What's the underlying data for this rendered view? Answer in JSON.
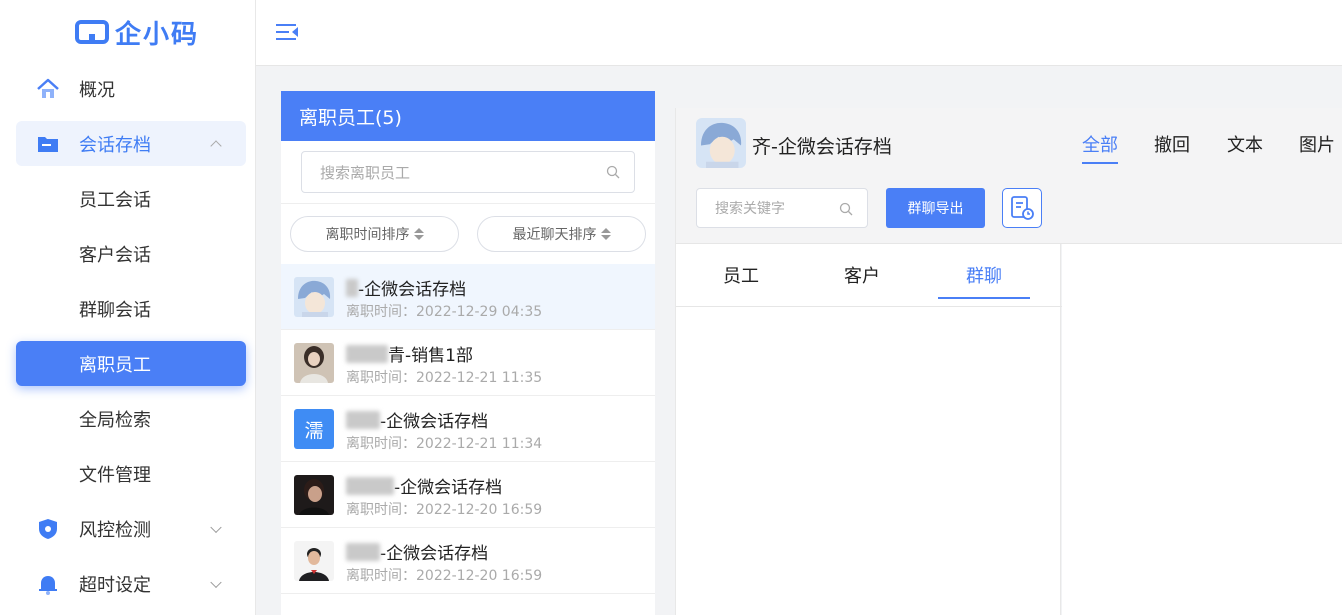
{
  "brand": {
    "name": "企小码",
    "color": "#3f7cf4"
  },
  "sidebar": {
    "items": [
      {
        "label": "概况",
        "icon": "home-icon"
      },
      {
        "label": "会话存档",
        "icon": "folder-icon",
        "state": "open"
      },
      {
        "label": "员工会话"
      },
      {
        "label": "客户会话"
      },
      {
        "label": "群聊会话"
      },
      {
        "label": "离职员工",
        "state": "active"
      },
      {
        "label": "全局检索"
      },
      {
        "label": "文件管理"
      },
      {
        "label": "风控检测",
        "icon": "shield-icon"
      },
      {
        "label": "超时设定",
        "icon": "bell-icon"
      }
    ]
  },
  "resigned": {
    "title": "离职员工(5)",
    "search_placeholder": "搜索离职员工",
    "sort_by_resign": "离职时间排序",
    "sort_by_chat": "最近聊天排序",
    "employees": [
      {
        "name": "-企微会话存档",
        "time": "离职时间：2022-12-29 04:35",
        "avatar": "anime-boy-avatar"
      },
      {
        "name": "青-销售1部",
        "time": "离职时间：2022-12-21 11:35",
        "avatar": "girl-photo-avatar"
      },
      {
        "name": "-企微会话存档",
        "time": "离职时间：2022-12-21 11:34",
        "avatar": "text-avatar",
        "avatar_text": "濡"
      },
      {
        "name": "-企微会话存档",
        "time": "离职时间：2022-12-20 16:59",
        "avatar": "dark-photo-avatar"
      },
      {
        "name": "-企微会话存档",
        "time": "离职时间：2022-12-20 16:59",
        "avatar": "suit-man-avatar"
      }
    ]
  },
  "chat": {
    "title": "齐-企微会话存档",
    "keyword_placeholder": "搜索关键字",
    "export_label": "群聊导出",
    "tabs": [
      "员工",
      "客户",
      "群聊"
    ],
    "active_tab": "群聊"
  },
  "messages": {
    "tabs": [
      "全部",
      "撤回",
      "文本",
      "图片"
    ],
    "active_tab": "全部"
  }
}
